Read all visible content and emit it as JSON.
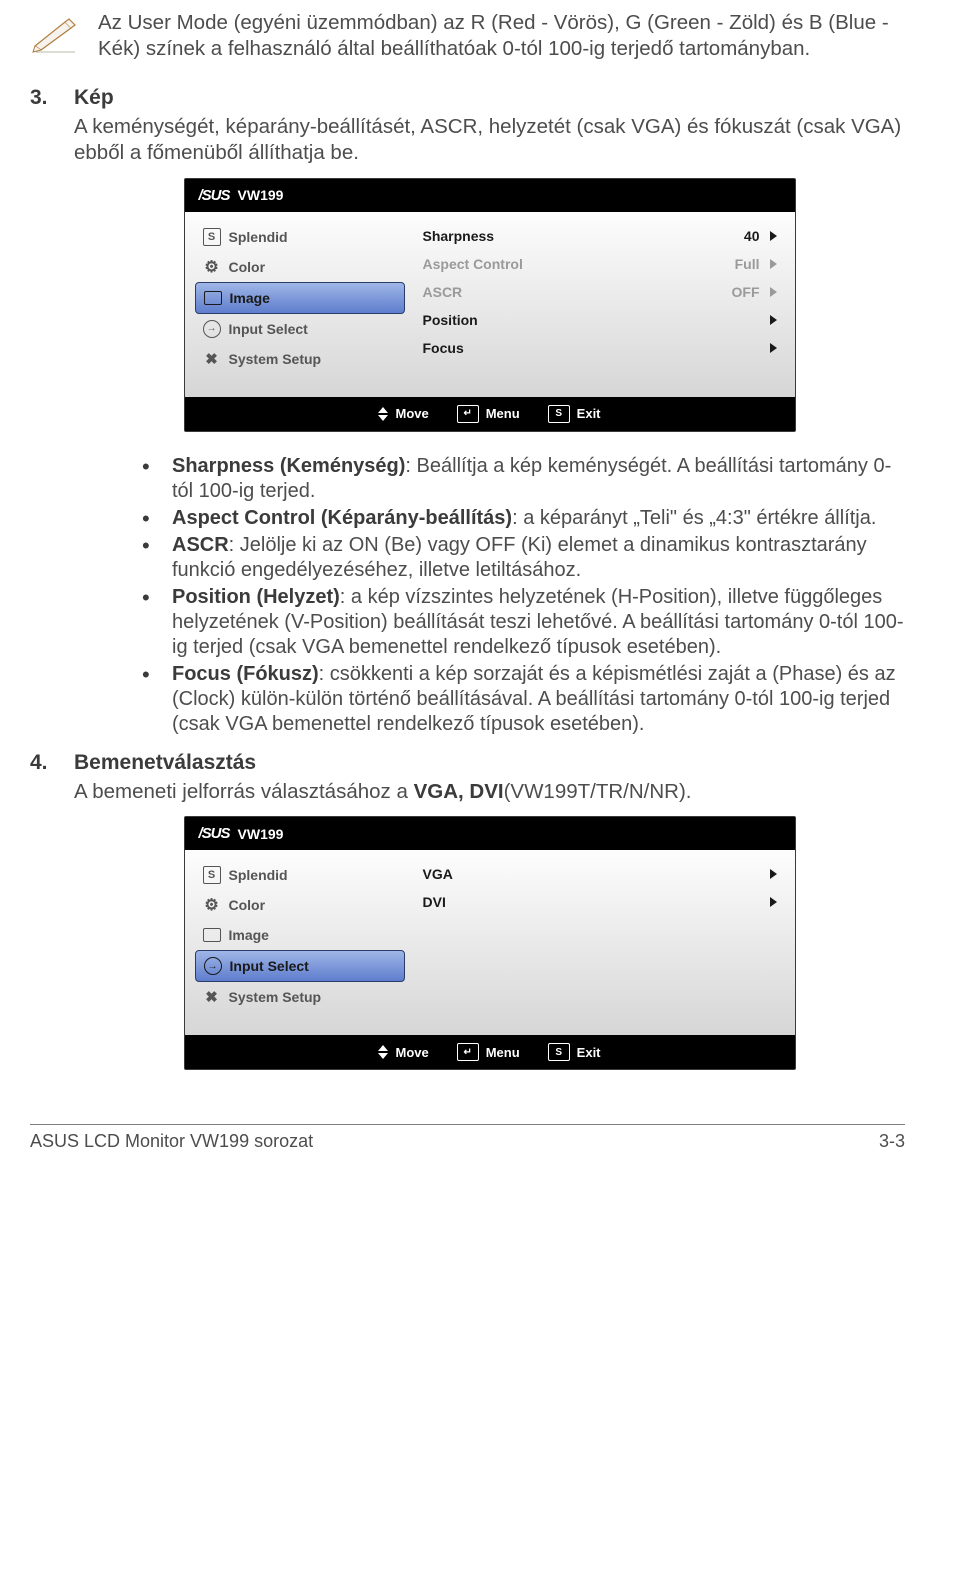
{
  "note": {
    "text": "Az User Mode (egyéni üzemmódban) az R (Red - Vörös), G (Green - Zöld) és B (Blue - Kék) színek a felhasználó által beállíthatóak 0-tól 100-ig terjedő tartományban."
  },
  "section3": {
    "num": "3.",
    "title": "Kép",
    "intro": "A keménységét, képarány-beállításét, ASCR, helyzetét (csak VGA) és fókuszát (csak VGA) ebből a főmenüből állíthatja be."
  },
  "osd1": {
    "model": "VW199",
    "left": [
      {
        "icon": "S",
        "label": "Splendid",
        "selected": false
      },
      {
        "icon": "color",
        "label": "Color",
        "selected": false
      },
      {
        "icon": "image",
        "label": "Image",
        "selected": true
      },
      {
        "icon": "input",
        "label": "Input Select",
        "selected": false
      },
      {
        "icon": "setup",
        "label": "System Setup",
        "selected": false
      }
    ],
    "right": [
      {
        "name": "Sharpness",
        "value": "40",
        "disabled": false,
        "arrow": true
      },
      {
        "name": "Aspect Control",
        "value": "Full",
        "disabled": true,
        "arrow": true
      },
      {
        "name": "ASCR",
        "value": "OFF",
        "disabled": true,
        "arrow": true
      },
      {
        "name": "Position",
        "value": "",
        "disabled": false,
        "arrow": true
      },
      {
        "name": "Focus",
        "value": "",
        "disabled": false,
        "arrow": true
      }
    ],
    "footer": {
      "move": "Move",
      "menu": "Menu",
      "exit": "Exit"
    }
  },
  "bullets3": [
    {
      "t": "Sharpness (Keménység)",
      "rest": ": Beállítja a kép keménységét. A beállítási tartomány 0-tól 100-ig terjed."
    },
    {
      "t": "Aspect Control (Képarány-beállítás)",
      "rest": ": a képarányt „Teli\" és „4:3\" értékre állítja."
    },
    {
      "t": "ASCR",
      "rest": ": Jelölje ki az ON (Be) vagy OFF (Ki) elemet a dinamikus kontrasztarány funkció engedélyezéséhez, illetve letiltásához."
    },
    {
      "t": "Position (Helyzet)",
      "rest": ": a kép vízszintes helyzetének (H-Position), illetve függőleges helyzetének (V-Position) beállítását teszi lehetővé. A beállítási tartomány 0-tól 100-ig terjed (csak VGA bemenettel rendelkező típusok esetében)."
    },
    {
      "t": "Focus (Fókusz)",
      "rest": ": csökkenti a kép sorzaját és a képismétlési zaját a (Phase) és az (Clock) külön-külön történő beállításával. A beállítási tartomány 0-tól 100-ig terjed (csak VGA bemenettel rendelkező típusok esetében)."
    }
  ],
  "section4": {
    "num": "4.",
    "title": "Bemenetválasztás",
    "intro_pre": "A bemeneti jelforrás választásához a ",
    "intro_strong": "VGA, DVI",
    "intro_post": "(VW199T/TR/N/NR)."
  },
  "osd2": {
    "model": "VW199",
    "left": [
      {
        "icon": "S",
        "label": "Splendid",
        "selected": false
      },
      {
        "icon": "color",
        "label": "Color",
        "selected": false
      },
      {
        "icon": "image",
        "label": "Image",
        "selected": false
      },
      {
        "icon": "input",
        "label": "Input Select",
        "selected": true
      },
      {
        "icon": "setup",
        "label": "System Setup",
        "selected": false
      }
    ],
    "right": [
      {
        "name": "VGA",
        "value": "",
        "disabled": false,
        "arrow": true
      },
      {
        "name": "DVI",
        "value": "",
        "disabled": false,
        "arrow": true
      }
    ],
    "footer": {
      "move": "Move",
      "menu": "Menu",
      "exit": "Exit"
    }
  },
  "footer": {
    "left": "ASUS LCD Monitor VW199 sorozat",
    "right": "3-3"
  }
}
